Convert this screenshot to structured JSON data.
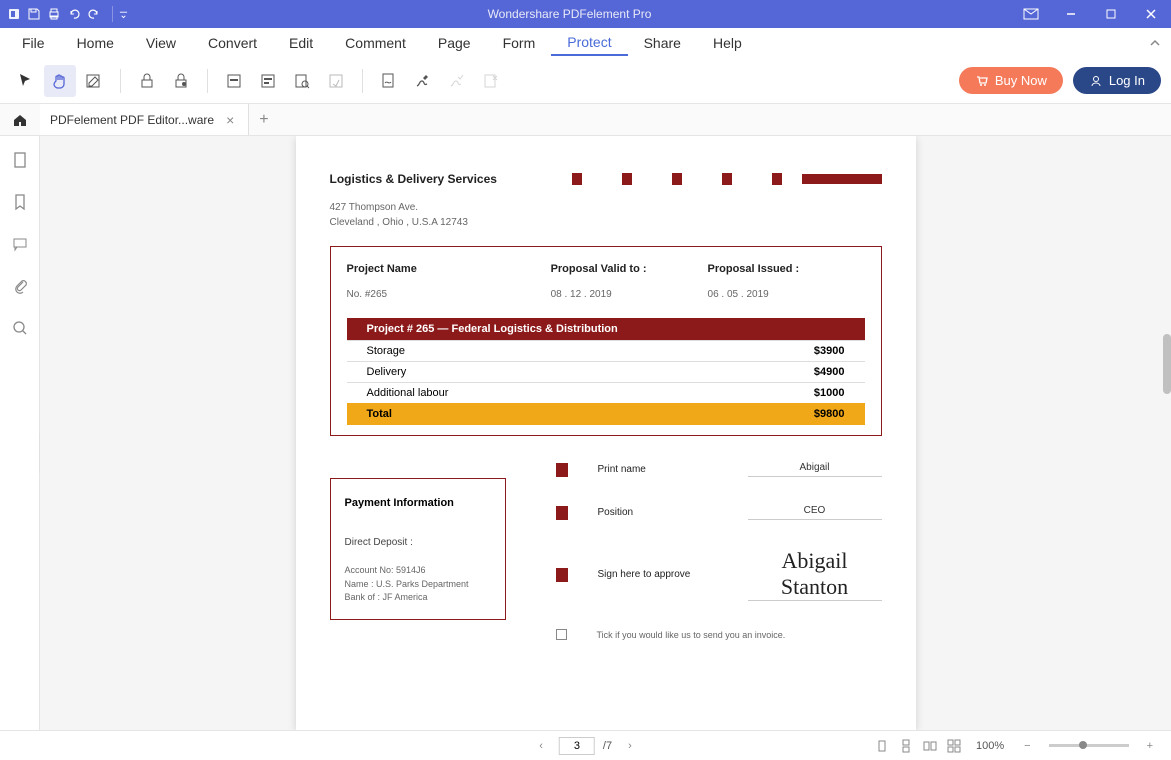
{
  "app": {
    "title": "Wondershare PDFelement Pro"
  },
  "menu": {
    "file": "File",
    "home": "Home",
    "view": "View",
    "convert": "Convert",
    "edit": "Edit",
    "comment": "Comment",
    "page": "Page",
    "form": "Form",
    "protect": "Protect",
    "share": "Share",
    "help": "Help"
  },
  "toolbar": {
    "buy": "Buy Now",
    "login": "Log In"
  },
  "tab": {
    "doc_name": "PDFelement  PDF Editor...ware"
  },
  "doc": {
    "company": "Logistics & Delivery Services",
    "addr1": "427 Thompson Ave.",
    "addr2": "Cleveland , Ohio , U.S.A 12743",
    "head": {
      "name": "Project Name",
      "valid": "Proposal Valid to :",
      "issued": "Proposal Issued :"
    },
    "vals": {
      "name": "No. #265",
      "valid": "08 . 12 . 2019",
      "issued": "06 . 05 . 2019"
    },
    "table": {
      "header": "Project # 265 — Federal Logistics & Distribution",
      "rows": [
        {
          "label": "Storage",
          "amount": "$3900"
        },
        {
          "label": "Delivery",
          "amount": "$4900"
        },
        {
          "label": "Additional labour",
          "amount": "$1000"
        }
      ],
      "total_label": "Total",
      "total_amount": "$9800"
    },
    "payment": {
      "title": "Payment Information",
      "sub": "Direct Deposit :",
      "acct": "Account No: 5914J6",
      "name": "Name :  U.S. Parks Department",
      "bank": "Bank of : JF America"
    },
    "sign": {
      "print_label": "Print name",
      "print_val": "Abigail",
      "pos_label": "Position",
      "pos_val": "CEO",
      "sign_label": "Sign here to approve",
      "sign_val": "Abigail Stanton",
      "tick": "Tick if you would like us to send you an invoice."
    }
  },
  "status": {
    "page_current": "3",
    "page_total": "/7",
    "zoom": "100%"
  }
}
